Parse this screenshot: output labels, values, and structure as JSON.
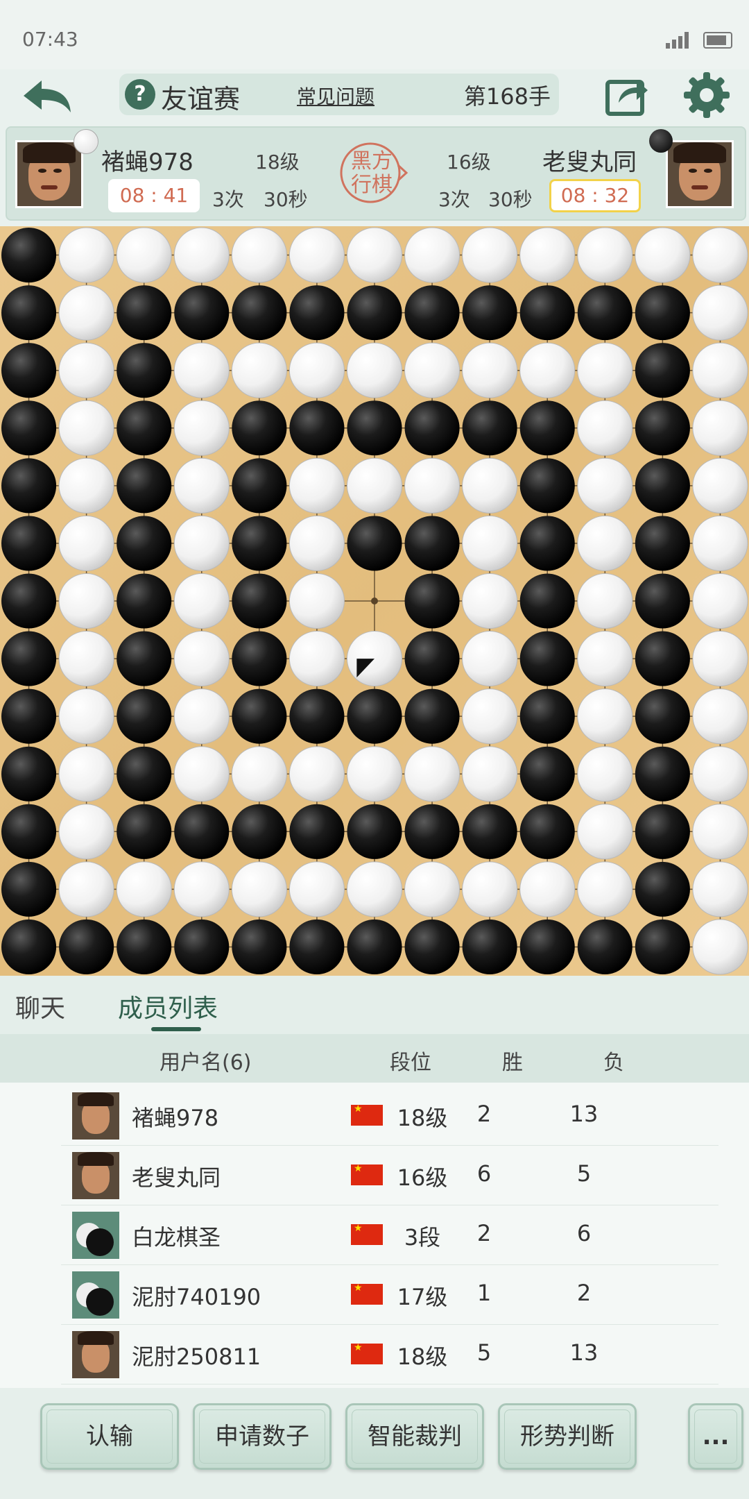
{
  "status_bar": {
    "time": "07:43"
  },
  "header": {
    "title": "友谊赛",
    "faq": "常见问题",
    "move_count": "第168手"
  },
  "players": {
    "left": {
      "name": "褚蝇978",
      "rank": "18级",
      "timer": "08 : 41",
      "byoyomi_count": "3次",
      "byoyomi_time": "30秒",
      "stone": "white"
    },
    "right": {
      "name": "老叟丸同",
      "rank": "16级",
      "timer": "08 : 32",
      "byoyomi_count": "3次",
      "byoyomi_time": "30秒",
      "stone": "black"
    },
    "turn_label_1": "黑方",
    "turn_label_2": "行棋"
  },
  "board": {
    "size": 13,
    "last_move": [
      7,
      6
    ],
    "rows": [
      "BWWWWWWWWWWWW",
      "BWBBBBBBBBBBW",
      "BWBWWWWWWWWBW",
      "BWBWBBBBBBWBW",
      "BWBWBWWWWBWBW",
      "BWBWBWBBWBWBW",
      "BWBWBW.BWBWBW",
      "BWBWBWWBWBWBW",
      "BWBWBBBBWBWBW",
      "BWBWWWWWWBWBW",
      "BWBBBBBBBBWBW",
      "BWWWWWWWWWWBW",
      "BBBBBBBBBBBBW"
    ]
  },
  "tabs": {
    "chat": "聊天",
    "members": "成员列表"
  },
  "members": {
    "headers": {
      "username": "用户名(6)",
      "rank": "段位",
      "wins": "胜",
      "losses": "负"
    },
    "rows": [
      {
        "name": "褚蝇978",
        "rank": "18级",
        "wins": "2",
        "losses": "13",
        "avatar": "face"
      },
      {
        "name": "老叟丸同",
        "rank": "16级",
        "wins": "6",
        "losses": "5",
        "avatar": "face"
      },
      {
        "name": "白龙棋圣",
        "rank": "3段",
        "wins": "2",
        "losses": "6",
        "avatar": "stones"
      },
      {
        "name": "泥肘740190",
        "rank": "17级",
        "wins": "1",
        "losses": "2",
        "avatar": "stones"
      },
      {
        "name": "泥肘250811",
        "rank": "18级",
        "wins": "5",
        "losses": "13",
        "avatar": "face"
      }
    ]
  },
  "actions": {
    "resign": "认输",
    "request_count": "申请数子",
    "ai_judge": "智能裁判",
    "position_eval": "形势判断",
    "more": "..."
  }
}
